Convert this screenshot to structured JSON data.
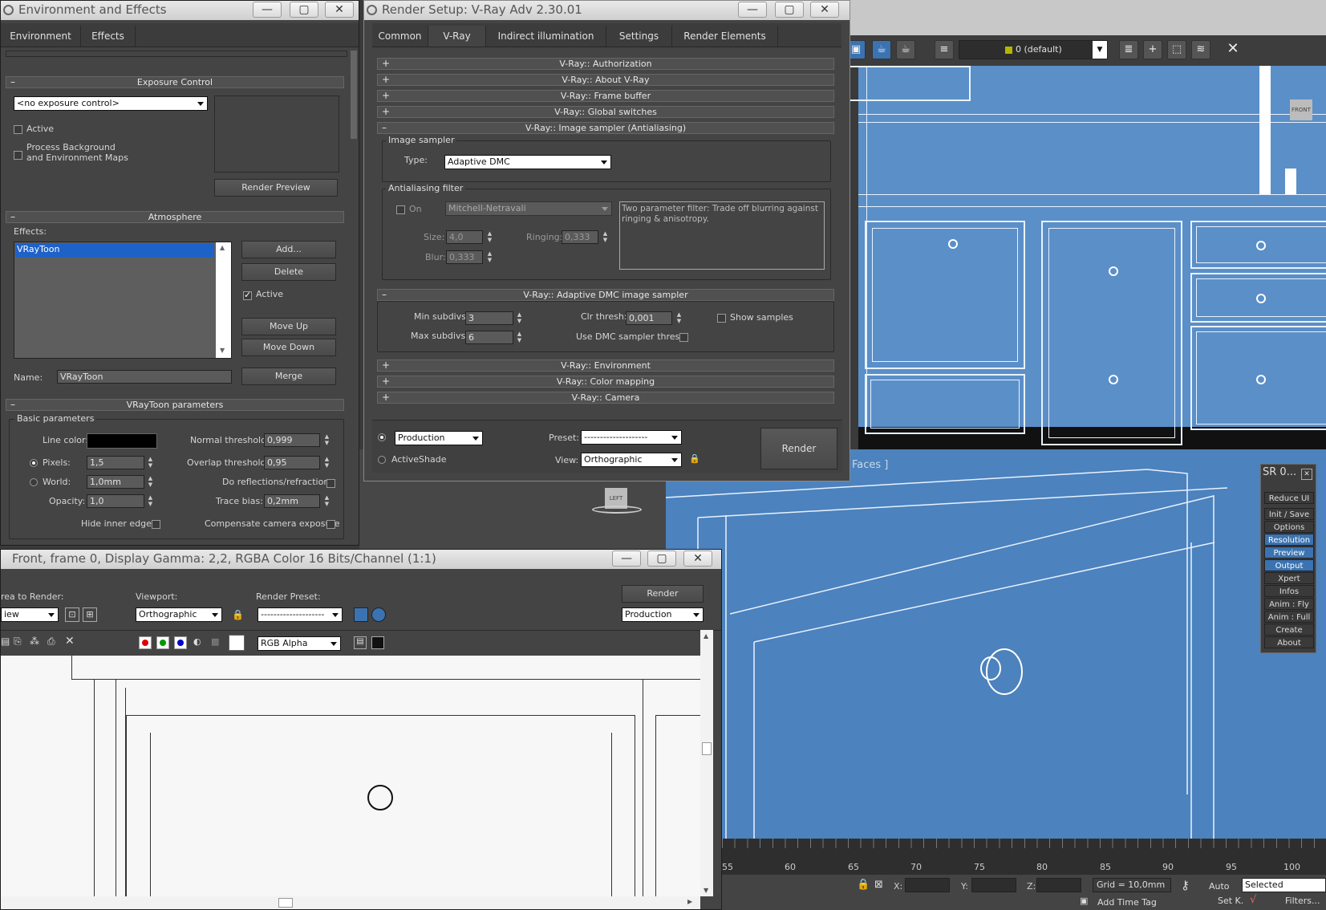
{
  "env": {
    "title": "Environment and Effects",
    "tabs": [
      "Environment",
      "Effects"
    ],
    "exposure": {
      "header": "Exposure Control",
      "select": "<no exposure control>",
      "active": "Active",
      "process_line1": "Process Background",
      "process_line2": "and Environment Maps",
      "render_preview": "Render Preview"
    },
    "atmosphere": {
      "header": "Atmosphere",
      "effects_label": "Effects:",
      "list_item": "VRayToon",
      "add": "Add...",
      "delete": "Delete",
      "active": "Active",
      "move_up": "Move Up",
      "move_down": "Move Down",
      "name_label": "Name:",
      "name_value": "VRayToon",
      "merge": "Merge"
    },
    "toon": {
      "header": "VRayToon parameters",
      "group": "Basic parameters",
      "line_color": "Line color:",
      "pixels": "Pixels:",
      "pixels_val": "1,5",
      "world": "World:",
      "world_val": "1,0mm",
      "opacity": "Opacity:",
      "opacity_val": "1,0",
      "hide_inner": "Hide inner edges",
      "normal": "Normal threshold:",
      "normal_val": "0,999",
      "overlap": "Overlap threshold:",
      "overlap_val": "0,95",
      "reflections": "Do reflections/refractions",
      "trace": "Trace bias:",
      "trace_val": "0,2mm",
      "compensate": "Compensate camera exposure"
    }
  },
  "rs": {
    "title": "Render Setup: V-Ray Adv 2.30.01",
    "tabs": [
      "Common",
      "V-Ray",
      "Indirect illumination",
      "Settings",
      "Render Elements"
    ],
    "rollouts": {
      "auth": "V-Ray:: Authorization",
      "about": "V-Ray:: About V-Ray",
      "frame": "V-Ray:: Frame buffer",
      "global": "V-Ray:: Global switches",
      "sampler": "V-Ray:: Image sampler (Antialiasing)",
      "dmc": "V-Ray:: Adaptive DMC image sampler",
      "environment": "V-Ray:: Environment",
      "color": "V-Ray:: Color mapping",
      "camera": "V-Ray:: Camera"
    },
    "image_sampler": {
      "group": "Image sampler",
      "type_label": "Type:",
      "type_value": "Adaptive DMC"
    },
    "aa": {
      "group": "Antialiasing filter",
      "on": "On",
      "filter": "Mitchell-Netravali",
      "desc": "Two parameter filter: Trade off blurring against ringing & anisotropy.",
      "size": "Size:",
      "size_val": "4,0",
      "ringing": "Ringing:",
      "ringing_val": "0,333",
      "blur": "Blur:",
      "blur_val": "0,333"
    },
    "dmc": {
      "min": "Min subdivs:",
      "min_val": "3",
      "max": "Max subdivs:",
      "max_val": "6",
      "clr": "Clr thresh:",
      "clr_val": "0,001",
      "show": "Show samples",
      "use": "Use DMC sampler thresh."
    },
    "bottom": {
      "production": "Production",
      "activeshade": "ActiveShade",
      "preset_label": "Preset:",
      "preset_val": "--------------------",
      "view_label": "View:",
      "view_val": "Orthographic",
      "render": "Render"
    }
  },
  "fb": {
    "title": "Front, frame 0, Display Gamma: 2,2, RGBA Color 16 Bits/Channel (1:1)",
    "area_label": "rea to Render:",
    "area_val": "iew",
    "viewport_label": "Viewport:",
    "viewport_val": "Orthographic",
    "preset_label": "Render Preset:",
    "preset_val": "--------------------",
    "render": "Render",
    "production": "Production",
    "channel": "RGB Alpha"
  },
  "max": {
    "layer": "0 (default)",
    "faces": "Faces ]",
    "front": "FRONT",
    "left": "LEFT",
    "timeline": [
      "55",
      "60",
      "65",
      "70",
      "75",
      "80",
      "85",
      "90",
      "95",
      "100"
    ],
    "x": "X:",
    "y": "Y:",
    "z": "Z:",
    "grid": "Grid = 10,0mm",
    "auto": "Auto",
    "selected": "Selected",
    "setk": "Set K.",
    "filters": "Filters...",
    "add_time_tag": "Add Time Tag",
    "sr": {
      "title": "SR 0...",
      "items": [
        "Reduce UI",
        "Init / Save",
        "Options",
        "Resolution",
        "Preview",
        "Output",
        "Xpert",
        "Infos",
        "Anim : Fly",
        "Anim : Full",
        "Create",
        "About"
      ]
    }
  }
}
